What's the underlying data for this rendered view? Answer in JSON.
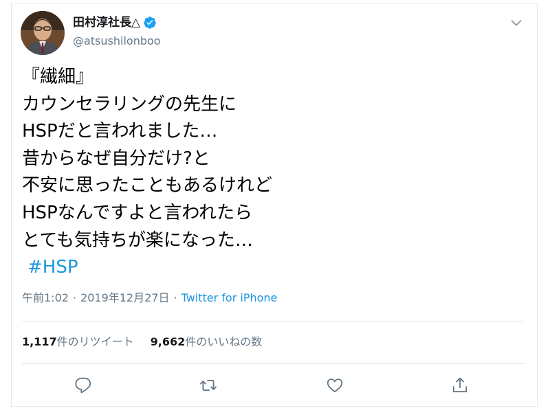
{
  "user": {
    "display_name": "田村淳社長△",
    "handle": "@atsushilonboo",
    "verified": true
  },
  "tweet": {
    "lines": [
      "『繊細』",
      "カウンセラリングの先生に",
      "HSPだと言われました…",
      "昔からなぜ自分だけ?と",
      "不安に思ったこともあるけれど",
      "HSPなんですよと言われたら",
      "とても気持ちが楽になった…"
    ],
    "hashtag": "#HSP"
  },
  "meta": {
    "time": "午前1:02",
    "separator": "·",
    "date": "2019年12月27日",
    "source": "Twitter for iPhone"
  },
  "stats": {
    "retweets_count": "1,117",
    "retweets_label": "件のリツイート",
    "likes_count": "9,662",
    "likes_label": "件のいいねの数"
  },
  "icons": {
    "verified": "verified-badge-icon",
    "caret": "chevron-down-icon",
    "reply": "reply-icon",
    "retweet": "retweet-icon",
    "like": "heart-icon",
    "share": "share-icon"
  },
  "colors": {
    "accent": "#1b95e0",
    "verified": "#1da1f2",
    "text": "#14171a",
    "secondary": "#657786",
    "border": "#e1e8ed"
  }
}
